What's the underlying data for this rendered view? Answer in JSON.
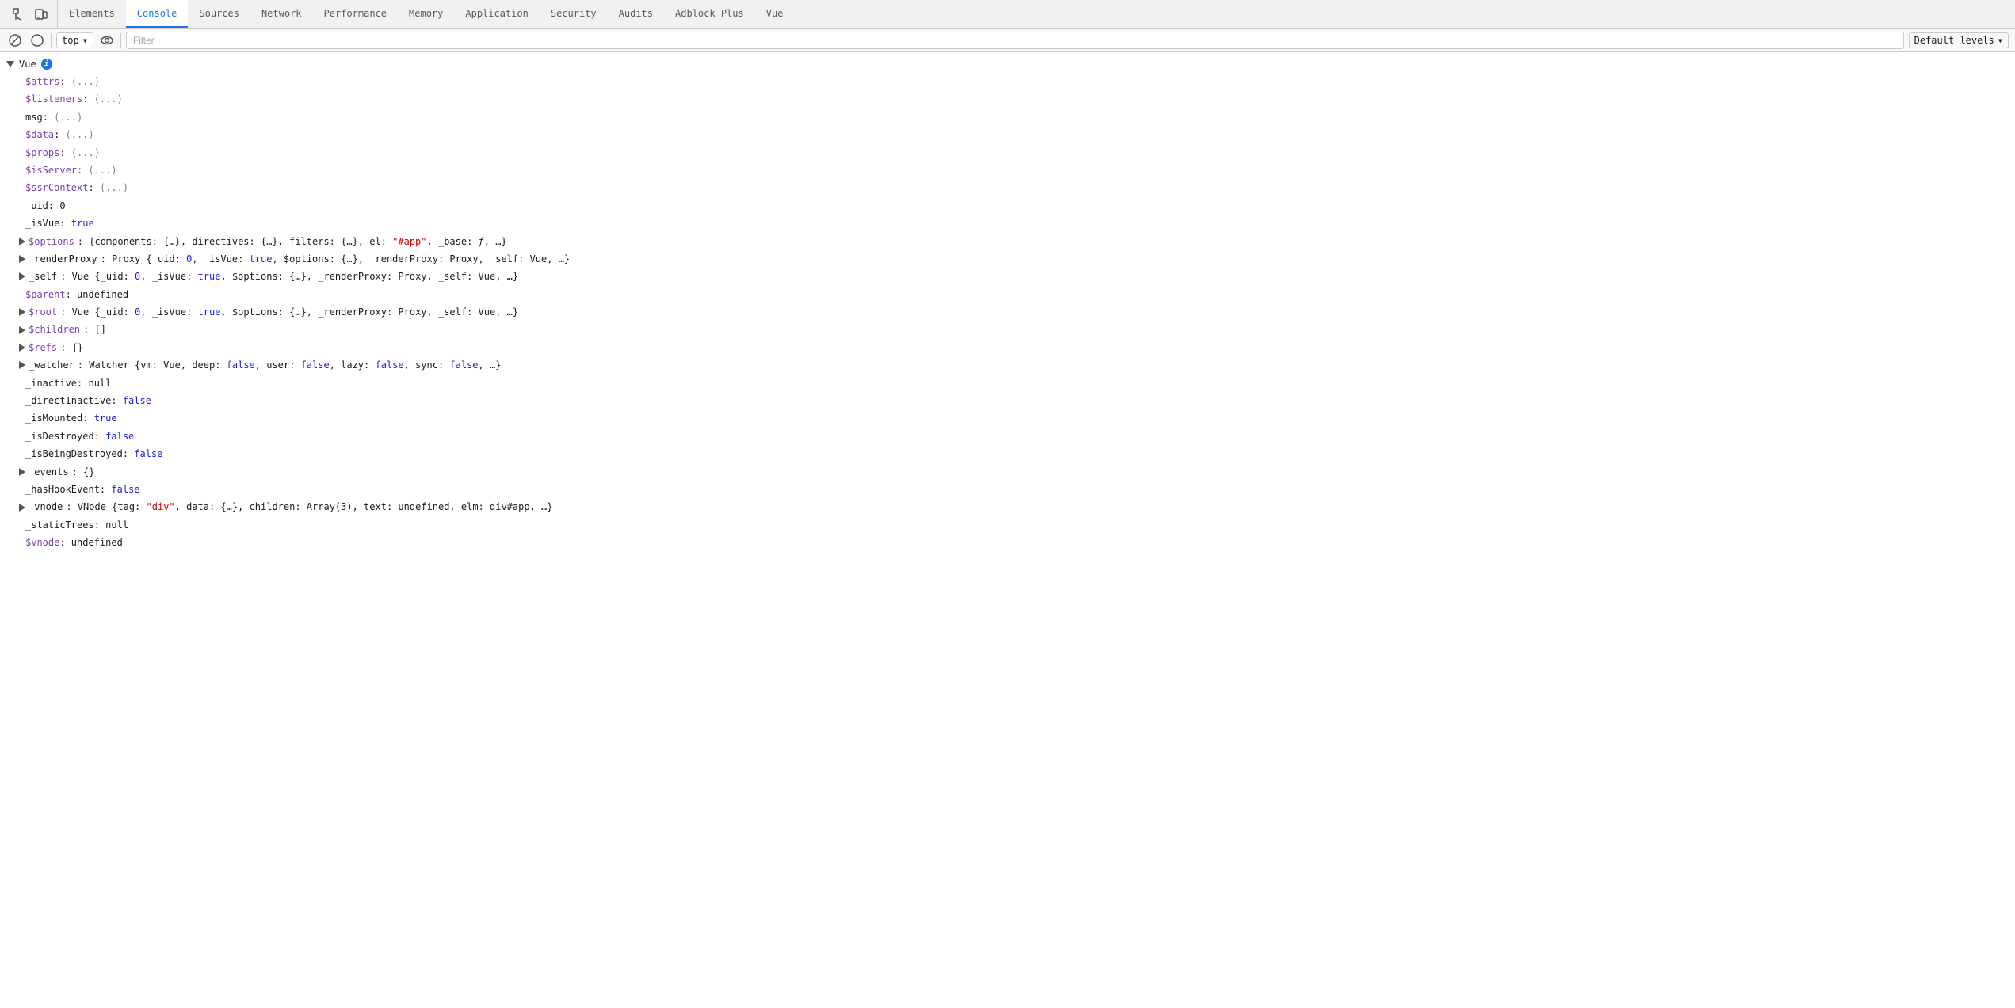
{
  "tabs": {
    "items": [
      {
        "id": "elements",
        "label": "Elements",
        "active": false
      },
      {
        "id": "console",
        "label": "Console",
        "active": true
      },
      {
        "id": "sources",
        "label": "Sources",
        "active": false
      },
      {
        "id": "network",
        "label": "Network",
        "active": false
      },
      {
        "id": "performance",
        "label": "Performance",
        "active": false
      },
      {
        "id": "memory",
        "label": "Memory",
        "active": false
      },
      {
        "id": "application",
        "label": "Application",
        "active": false
      },
      {
        "id": "security",
        "label": "Security",
        "active": false
      },
      {
        "id": "audits",
        "label": "Audits",
        "active": false
      },
      {
        "id": "adblock",
        "label": "Adblock Plus",
        "active": false
      },
      {
        "id": "vue",
        "label": "Vue",
        "active": false
      }
    ]
  },
  "toolbar": {
    "context_value": "top",
    "context_dropdown": "▾",
    "filter_placeholder": "Filter",
    "level_label": "Default levels",
    "level_dropdown": "▾"
  },
  "console": {
    "vue_label": "Vue",
    "entries": [
      {
        "type": "prop",
        "indent": 1,
        "key": "$attrs",
        "value": "(...)",
        "key_color": "purple"
      },
      {
        "type": "prop",
        "indent": 1,
        "key": "$listeners",
        "value": "(...)",
        "key_color": "purple"
      },
      {
        "type": "prop",
        "indent": 1,
        "key": "msg",
        "value": "(...)",
        "key_color": "dark"
      },
      {
        "type": "prop",
        "indent": 1,
        "key": "$data",
        "value": "(...)",
        "key_color": "purple"
      },
      {
        "type": "prop",
        "indent": 1,
        "key": "$props",
        "value": "(...)",
        "key_color": "purple"
      },
      {
        "type": "prop",
        "indent": 1,
        "key": "$isServer",
        "value": "(...)",
        "key_color": "purple"
      },
      {
        "type": "prop",
        "indent": 1,
        "key": "$ssrContext",
        "value": "(...)",
        "key_color": "purple"
      },
      {
        "type": "prop",
        "indent": 1,
        "key": "_uid",
        "value": "0",
        "key_color": "dark"
      },
      {
        "type": "prop",
        "indent": 1,
        "key": "_isVue",
        "value": "true",
        "key_color": "dark",
        "value_color": "blue"
      },
      {
        "type": "collapsible",
        "indent": 1,
        "key": "$options",
        "value": "{components: {…}, directives: {…}, filters: {…}, el: ",
        "mid_red": "\"#app\"",
        "value2": ", _base: ƒ, …}",
        "key_color": "purple"
      },
      {
        "type": "collapsible",
        "indent": 1,
        "key": "_renderProxy",
        "value": "Proxy {_uid: 0, _isVue: true, $options: {…}, _renderProxy: Proxy, _self: Vue, …}",
        "key_color": "dark"
      },
      {
        "type": "collapsible",
        "indent": 1,
        "key": "_self",
        "value": "Vue {_uid: 0, _isVue: true, $options: {…}, _renderProxy: Proxy, _self: Vue, …}",
        "key_color": "dark"
      },
      {
        "type": "prop",
        "indent": 1,
        "key": "$parent",
        "value": "undefined",
        "key_color": "purple"
      },
      {
        "type": "collapsible",
        "indent": 1,
        "key": "$root",
        "value": "Vue {_uid: 0, _isVue: true, $options: {…}, _renderProxy: Proxy, _self: Vue, …}",
        "key_color": "purple"
      },
      {
        "type": "collapsible",
        "indent": 1,
        "key": "$children",
        "value": "[]",
        "key_color": "purple"
      },
      {
        "type": "collapsible",
        "indent": 1,
        "key": "$refs",
        "value": "{}",
        "key_color": "purple"
      },
      {
        "type": "collapsible",
        "indent": 1,
        "key": "_watcher",
        "value": "Watcher {vm: Vue, deep: false, user: false, lazy: false, sync: false, …}",
        "key_color": "dark",
        "has_booleans": true
      },
      {
        "type": "prop",
        "indent": 1,
        "key": "_inactive",
        "value": "null",
        "key_color": "dark"
      },
      {
        "type": "prop",
        "indent": 1,
        "key": "_directInactive",
        "value": "false",
        "key_color": "dark",
        "value_color": "blue"
      },
      {
        "type": "prop",
        "indent": 1,
        "key": "_isMounted",
        "value": "true",
        "key_color": "dark",
        "value_color": "blue"
      },
      {
        "type": "prop",
        "indent": 1,
        "key": "_isDestroyed",
        "value": "false",
        "key_color": "dark",
        "value_color": "blue"
      },
      {
        "type": "prop",
        "indent": 1,
        "key": "_isBeingDestroyed",
        "value": "false",
        "key_color": "dark",
        "value_color": "blue"
      },
      {
        "type": "collapsible",
        "indent": 1,
        "key": "_events",
        "value": "{}",
        "key_color": "dark"
      },
      {
        "type": "prop",
        "indent": 1,
        "key": "_hasHookEvent",
        "value": "false",
        "key_color": "dark",
        "value_color": "blue"
      },
      {
        "type": "collapsible",
        "indent": 1,
        "key": "_vnode",
        "value": "VNode {tag: ",
        "mid_red": "\"div\"",
        "value2": ", data: {…}, children: Array(3), text: undefined, elm: div#app, …}",
        "key_color": "dark"
      },
      {
        "type": "prop",
        "indent": 1,
        "key": "_staticTrees",
        "value": "null",
        "key_color": "dark"
      },
      {
        "type": "prop",
        "indent": 1,
        "key": "$vnode",
        "value": "undefined",
        "key_color": "purple"
      }
    ]
  }
}
